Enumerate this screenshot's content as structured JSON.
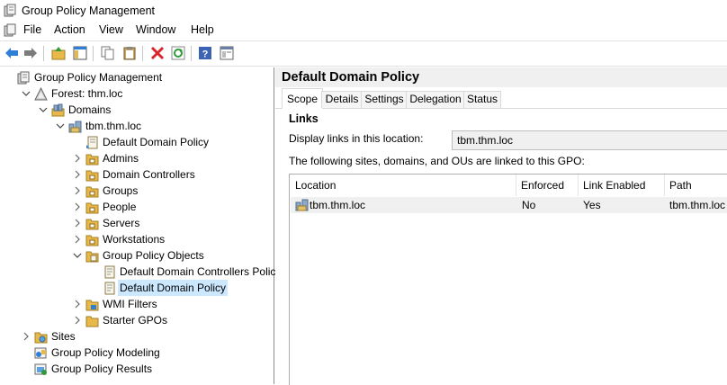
{
  "window": {
    "title": "Group Policy Management"
  },
  "menu": [
    "File",
    "Action",
    "View",
    "Window",
    "Help"
  ],
  "toolbar_icons": [
    "back-arrow-icon",
    "forward-arrow-icon",
    "up-folder-icon",
    "show-hide-tree-icon",
    "copy-icon",
    "paste-icon",
    "delete-icon",
    "refresh-icon",
    "help-icon",
    "properties-icon"
  ],
  "tree": [
    {
      "label": "Group Policy Management",
      "level": 0,
      "expander": "",
      "icon": "gpm-icon"
    },
    {
      "label": "Forest: thm.loc",
      "level": 1,
      "expander": "open",
      "icon": "forest-icon"
    },
    {
      "label": "Domains",
      "level": 2,
      "expander": "open",
      "icon": "domains-icon"
    },
    {
      "label": "tbm.thm.loc",
      "level": 3,
      "expander": "open",
      "icon": "domain-icon"
    },
    {
      "label": "Default Domain Policy",
      "level": 4,
      "expander": "",
      "icon": "gpo-link-icon"
    },
    {
      "label": "Admins",
      "level": 4,
      "expander": "closed",
      "icon": "ou-folder-icon"
    },
    {
      "label": "Domain Controllers",
      "level": 4,
      "expander": "closed",
      "icon": "ou-folder-icon"
    },
    {
      "label": "Groups",
      "level": 4,
      "expander": "closed",
      "icon": "ou-folder-icon"
    },
    {
      "label": "People",
      "level": 4,
      "expander": "closed",
      "icon": "ou-folder-icon"
    },
    {
      "label": "Servers",
      "level": 4,
      "expander": "closed",
      "icon": "ou-folder-icon"
    },
    {
      "label": "Workstations",
      "level": 4,
      "expander": "closed",
      "icon": "ou-folder-icon"
    },
    {
      "label": "Group Policy Objects",
      "level": 4,
      "expander": "open",
      "icon": "gpo-folder-icon"
    },
    {
      "label": "Default Domain Controllers Policy",
      "level": 5,
      "expander": "",
      "icon": "gpo-icon"
    },
    {
      "label": "Default Domain Policy",
      "level": 5,
      "expander": "",
      "icon": "gpo-icon",
      "selected": true
    },
    {
      "label": "WMI Filters",
      "level": 4,
      "expander": "closed",
      "icon": "wmi-folder-icon"
    },
    {
      "label": "Starter GPOs",
      "level": 4,
      "expander": "closed",
      "icon": "folder-icon"
    },
    {
      "label": "Sites",
      "level": 1,
      "expander": "closed",
      "icon": "sites-icon"
    },
    {
      "label": "Group Policy Modeling",
      "level": 1,
      "expander": "",
      "icon": "modeling-icon"
    },
    {
      "label": "Group Policy Results",
      "level": 1,
      "expander": "",
      "icon": "results-icon"
    }
  ],
  "detail": {
    "title": "Default Domain Policy",
    "tabs": [
      "Scope",
      "Details",
      "Settings",
      "Delegation",
      "Status"
    ],
    "active_tab": "Scope",
    "links_heading": "Links",
    "display_links_label": "Display links in this location:",
    "display_links_value": "tbm.thm.loc",
    "linked_text": "The following sites, domains, and OUs are linked to this GPO:",
    "columns": [
      "Location",
      "Enforced",
      "Link Enabled",
      "Path"
    ],
    "rows": [
      {
        "location": "tbm.thm.loc",
        "enforced": "No",
        "link_enabled": "Yes",
        "path": "tbm.thm.loc"
      }
    ]
  },
  "colors": {
    "selection": "#cce8ff",
    "header_bg": "#f0f0f0",
    "folder": "#e8b84a"
  }
}
